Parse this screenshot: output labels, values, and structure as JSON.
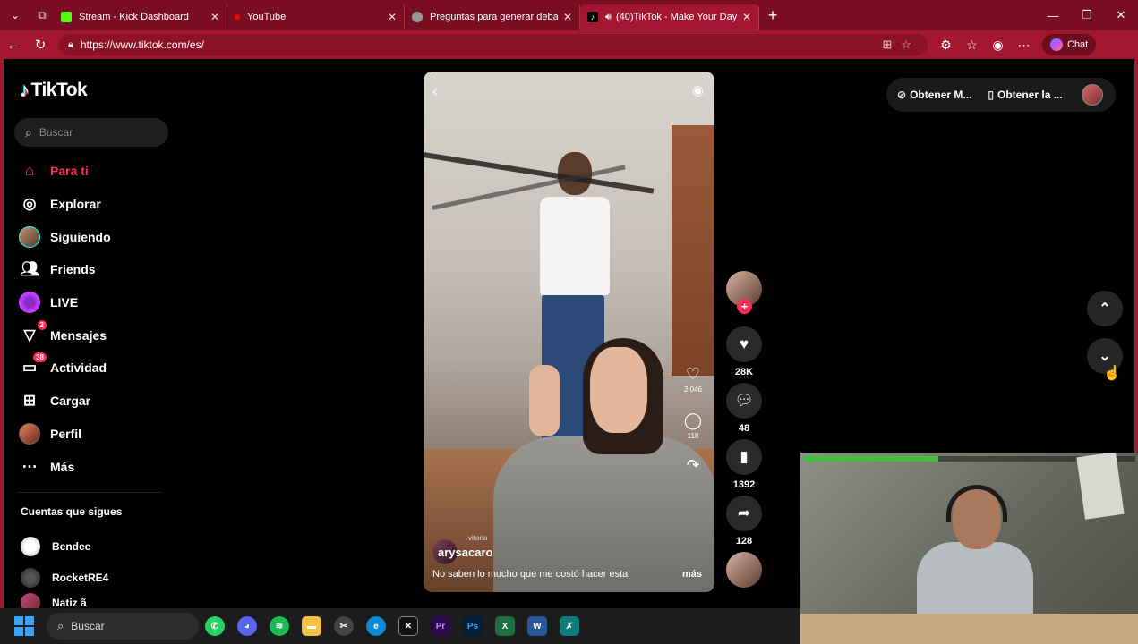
{
  "browser": {
    "tabs": [
      {
        "title": "Stream - Kick Dashboard",
        "color": "#53fc18"
      },
      {
        "title": "YouTube",
        "color": "#ff0000"
      },
      {
        "title": "Preguntas para generar debate",
        "color": "#999999"
      },
      {
        "title": "(40)TikTok - Make Your Day",
        "color": "#ffffff"
      }
    ],
    "url": "https://www.tiktok.com/es/",
    "chat_label": "Chat"
  },
  "sidebar": {
    "brand": "TikTok",
    "search_placeholder": "Buscar",
    "nav": [
      {
        "label": "Para ti",
        "icon": "home-icon"
      },
      {
        "label": "Explorar",
        "icon": "compass-icon"
      },
      {
        "label": "Siguiendo",
        "icon": "following-avatar-icon"
      },
      {
        "label": "Friends",
        "icon": "friends-icon"
      },
      {
        "label": "LIVE",
        "icon": "live-icon"
      },
      {
        "label": "Mensajes",
        "icon": "send-icon",
        "badge": "2"
      },
      {
        "label": "Actividad",
        "icon": "inbox-icon",
        "badge": "38"
      },
      {
        "label": "Cargar",
        "icon": "upload-icon"
      },
      {
        "label": "Perfil",
        "icon": "profile-avatar-icon"
      },
      {
        "label": "Más",
        "icon": "more-icon"
      }
    ],
    "following_title": "Cuentas que sigues",
    "following": [
      {
        "name": "Bendee"
      },
      {
        "name": "RocketRE4"
      },
      {
        "name": "Natiz ã"
      }
    ]
  },
  "video": {
    "username": "arysacaro",
    "sub_label": "vitoria",
    "caption": "No saben lo mucho que me costó hacer esta",
    "more_label": "más",
    "inner_likes": "2,046",
    "inner_comments": "118"
  },
  "rail": {
    "likes": "28K",
    "comments": "48",
    "saves": "1392",
    "shares": "128"
  },
  "topright": {
    "get_app_1": "Obtener M...",
    "get_app_2": "Obtener la ..."
  },
  "taskbar": {
    "search_placeholder": "Buscar"
  }
}
